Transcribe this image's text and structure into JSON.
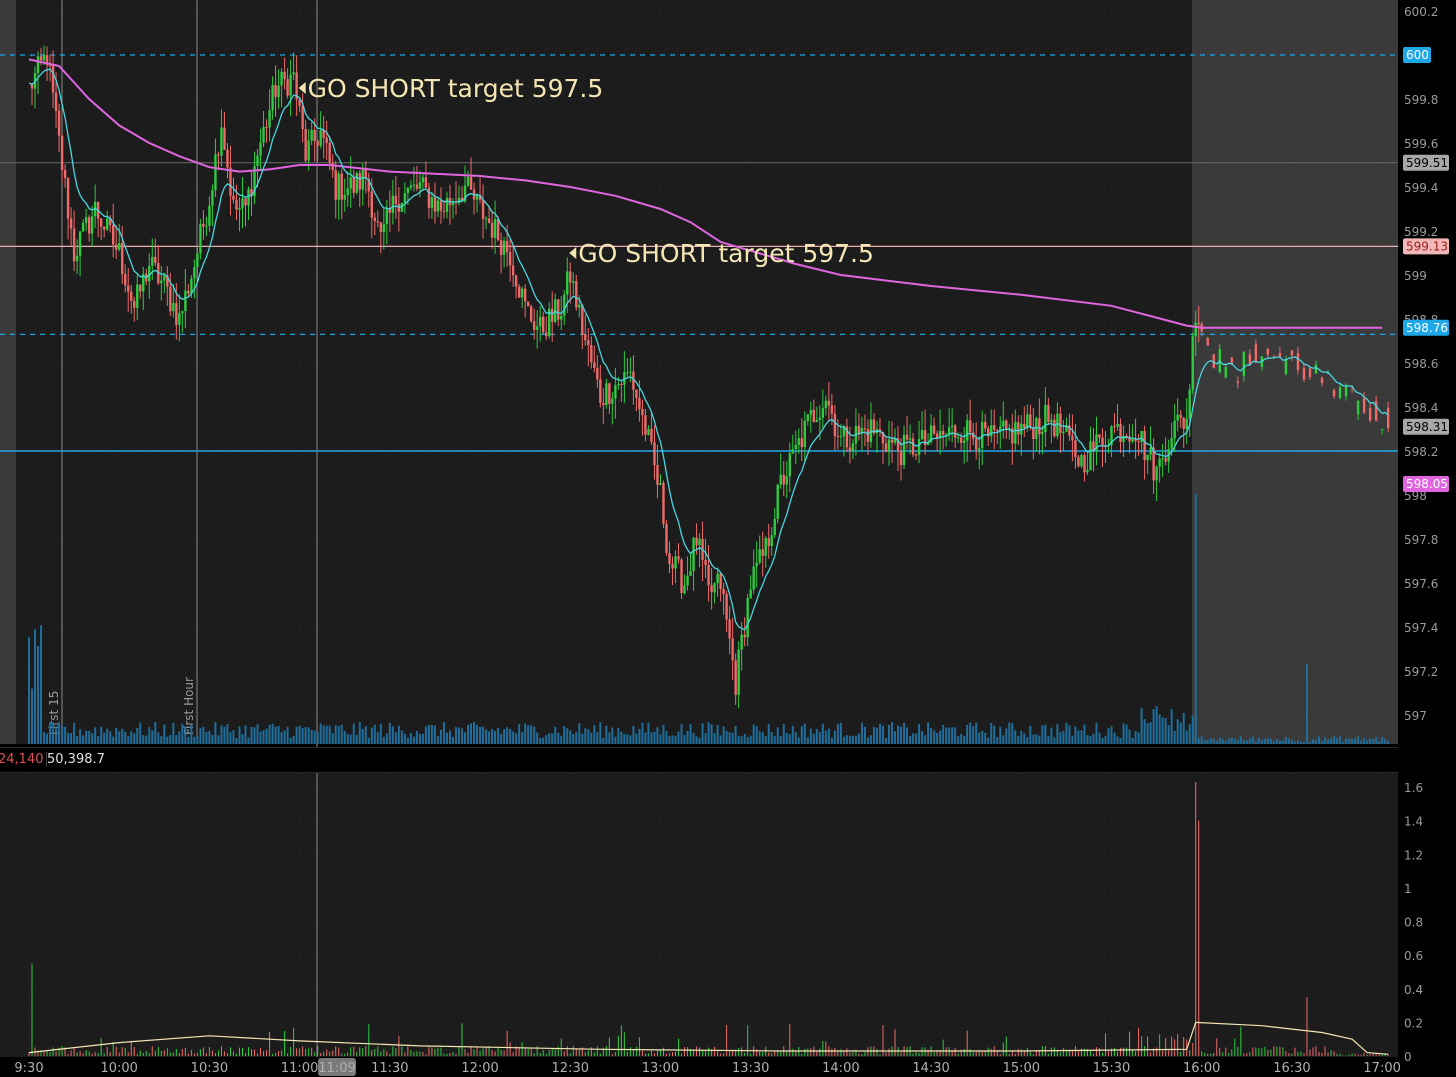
{
  "chart_data": [
    {
      "type": "candlestick",
      "yaxis_ticks": [
        "600.2",
        "599.8",
        "599.6",
        "599.4",
        "599.2",
        "599",
        "598.8",
        "598.6",
        "598.4",
        "598.2",
        "598",
        "597.8",
        "597.6",
        "597.4",
        "597.2",
        "597"
      ],
      "ylim": [
        596.85,
        600.25
      ],
      "xaxis_ticks": [
        "9:30",
        "10:00",
        "10:30",
        "11:00",
        "11:30",
        "12:00",
        "12:30",
        "13:00",
        "13:30",
        "14:00",
        "14:30",
        "15:00",
        "15:30",
        "16:00",
        "16:30",
        "17:00"
      ],
      "cursor_time": "11:09",
      "event_labels": [
        "First 15",
        "First Hour"
      ],
      "annotations": [
        {
          "text": "GO SHORT target 597.5",
          "time": "11:02",
          "price": 599.85
        },
        {
          "text": "GO SHORT target 597.5",
          "time": "12:32",
          "price": 599.1
        }
      ],
      "price_tags": [
        {
          "label": "600",
          "value": 600.0,
          "color": "#1ea7e8"
        },
        {
          "label": "599.51",
          "value": 599.51,
          "color": "#a8a8a8"
        },
        {
          "label": "599.13",
          "value": 599.13,
          "color": "#f2b7b7"
        },
        {
          "label": "598.76",
          "value": 598.76,
          "color": "#1ea7e8"
        },
        {
          "label": "598.31",
          "value": 598.31,
          "color": "#a8a8a8"
        },
        {
          "label": "598.05",
          "value": 598.05,
          "color": "#e066e0"
        }
      ],
      "levels": [
        {
          "value": 600.0,
          "style": "dashed",
          "color": "#1ea7e8"
        },
        {
          "value": 599.13,
          "style": "solid",
          "color": "#e8b0b0"
        },
        {
          "value": 598.73,
          "style": "dashed",
          "color": "#1ea7e8"
        },
        {
          "value": 598.2,
          "style": "solid",
          "color": "#1ea7e8"
        }
      ],
      "price_path": [
        [
          "9:30",
          599.85
        ],
        [
          "9:36",
          600.0
        ],
        [
          "9:40",
          599.6
        ],
        [
          "9:45",
          599.1
        ],
        [
          "9:52",
          599.3
        ],
        [
          "10:00",
          599.1
        ],
        [
          "10:05",
          598.85
        ],
        [
          "10:10",
          599.05
        ],
        [
          "10:15",
          598.95
        ],
        [
          "10:20",
          598.8
        ],
        [
          "10:25",
          599.05
        ],
        [
          "10:30",
          599.35
        ],
        [
          "10:34",
          599.7
        ],
        [
          "10:38",
          599.3
        ],
        [
          "10:42",
          599.3
        ],
        [
          "10:46",
          599.55
        ],
        [
          "10:52",
          599.85
        ],
        [
          "10:58",
          599.9
        ],
        [
          "11:02",
          599.55
        ],
        [
          "11:07",
          599.65
        ],
        [
          "11:12",
          599.4
        ],
        [
          "11:18",
          599.4
        ],
        [
          "11:22",
          599.45
        ],
        [
          "11:27",
          599.15
        ],
        [
          "11:32",
          599.35
        ],
        [
          "11:40",
          599.4
        ],
        [
          "11:47",
          599.3
        ],
        [
          "11:55",
          599.4
        ],
        [
          "12:00",
          599.3
        ],
        [
          "12:05",
          599.2
        ],
        [
          "12:10",
          599.1
        ],
        [
          "12:15",
          598.85
        ],
        [
          "12:20",
          598.75
        ],
        [
          "12:27",
          598.85
        ],
        [
          "12:30",
          599.0
        ],
        [
          "12:35",
          598.7
        ],
        [
          "12:40",
          598.45
        ],
        [
          "12:45",
          598.5
        ],
        [
          "12:50",
          598.55
        ],
        [
          "12:55",
          598.3
        ],
        [
          "13:00",
          598.0
        ],
        [
          "13:03",
          597.7
        ],
        [
          "13:08",
          597.6
        ],
        [
          "13:12",
          597.8
        ],
        [
          "13:16",
          597.55
        ],
        [
          "13:20",
          597.6
        ],
        [
          "13:25",
          597.15
        ],
        [
          "13:30",
          597.6
        ],
        [
          "13:35",
          597.75
        ],
        [
          "13:40",
          598.05
        ],
        [
          "13:45",
          598.2
        ],
        [
          "13:50",
          598.35
        ],
        [
          "13:55",
          598.45
        ],
        [
          "14:00",
          598.25
        ],
        [
          "14:10",
          598.3
        ],
        [
          "14:20",
          598.2
        ],
        [
          "14:30",
          598.25
        ],
        [
          "14:40",
          598.3
        ],
        [
          "14:50",
          598.25
        ],
        [
          "15:00",
          598.3
        ],
        [
          "15:10",
          598.35
        ],
        [
          "15:20",
          598.15
        ],
        [
          "15:30",
          598.3
        ],
        [
          "15:38",
          598.3
        ],
        [
          "15:45",
          598.1
        ],
        [
          "15:50",
          598.3
        ],
        [
          "15:55",
          598.35
        ],
        [
          "15:58",
          598.85
        ],
        [
          "16:03",
          598.65
        ],
        [
          "16:10",
          598.55
        ],
        [
          "16:20",
          598.65
        ],
        [
          "16:30",
          598.6
        ],
        [
          "16:38",
          598.55
        ],
        [
          "16:45",
          598.45
        ],
        [
          "16:55",
          598.4
        ],
        [
          "17:00",
          598.35
        ]
      ],
      "vwap_path": [
        [
          "9:30",
          599.98
        ],
        [
          "9:40",
          599.95
        ],
        [
          "9:50",
          599.8
        ],
        [
          "10:00",
          599.68
        ],
        [
          "10:10",
          599.6
        ],
        [
          "10:20",
          599.54
        ],
        [
          "10:30",
          599.49
        ],
        [
          "10:40",
          599.47
        ],
        [
          "10:50",
          599.48
        ],
        [
          "11:00",
          599.5
        ],
        [
          "11:10",
          599.5
        ],
        [
          "11:30",
          599.47
        ],
        [
          "11:45",
          599.46
        ],
        [
          "12:00",
          599.45
        ],
        [
          "12:15",
          599.43
        ],
        [
          "12:30",
          599.4
        ],
        [
          "12:45",
          599.36
        ],
        [
          "13:00",
          599.3
        ],
        [
          "13:10",
          599.24
        ],
        [
          "13:20",
          599.15
        ],
        [
          "13:30",
          599.11
        ],
        [
          "13:45",
          599.05
        ],
        [
          "14:00",
          599.0
        ],
        [
          "14:30",
          598.95
        ],
        [
          "15:00",
          598.91
        ],
        [
          "15:30",
          598.86
        ],
        [
          "15:55",
          598.77
        ],
        [
          "16:00",
          598.76
        ],
        [
          "17:00",
          598.76
        ]
      ],
      "volume_profile": "low steady volume with spike at 15:58 close"
    },
    {
      "type": "bar",
      "study_values": [
        "24,140",
        "50,398.7"
      ],
      "yaxis_ticks": [
        "1.6",
        "1.4",
        "1.2",
        "1",
        "0.8",
        "0.6",
        "0.4",
        "0.2",
        "0"
      ],
      "ylim": [
        0,
        1.65
      ],
      "spikes": [
        [
          "9:31",
          0.55
        ],
        [
          "15:58",
          1.63
        ],
        [
          "16:35",
          0.35
        ]
      ]
    }
  ]
}
